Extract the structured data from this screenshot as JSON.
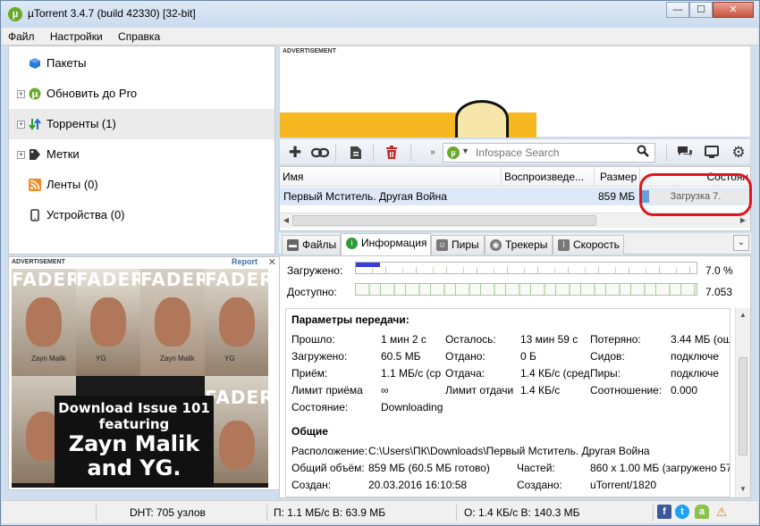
{
  "window": {
    "title": "µTorrent 3.4.7  (build 42330) [32-bit]",
    "controls": {
      "minimize": "—",
      "maximize": "☐",
      "close": "✕"
    }
  },
  "menu": [
    "Файл",
    "Настройки",
    "Справка"
  ],
  "sidebar": {
    "items": [
      {
        "label": "Пакеты",
        "icon": "package-icon"
      },
      {
        "label": "Обновить до Pro",
        "icon": "utorrent-logo-icon"
      },
      {
        "label": "Торренты (1)",
        "icon": "torrents-arrows-icon"
      },
      {
        "label": "Метки",
        "icon": "tag-icon"
      },
      {
        "label": "Ленты (0)",
        "icon": "rss-icon"
      },
      {
        "label": "Устройства (0)",
        "icon": "device-icon"
      }
    ]
  },
  "left_ad": {
    "label": "ADVERTISEMENT",
    "report": "Report",
    "close": "✕",
    "magazine_title": "FADER",
    "cover_names": [
      "Zayn Malik",
      "YG"
    ],
    "line1": "Download Issue 101",
    "line2": "featuring",
    "line3": "Zayn Malik",
    "line4": "and YG."
  },
  "top_ad": {
    "label": "ADVERTISEMENT"
  },
  "toolbar": {
    "search_placeholder": "Infospace Search",
    "icons": [
      "add-torrent-icon",
      "add-link-icon",
      "create-torrent-icon",
      "delete-icon",
      "chat-icon",
      "remote-icon",
      "settings-icon"
    ]
  },
  "torrent_list": {
    "columns": [
      "Имя",
      "Воспроизведе...",
      "Размер",
      "Состоян"
    ],
    "rows": [
      {
        "name": "Первый Мститель. Другая Война",
        "play": "",
        "size": "859 МБ",
        "status": "Загрузка 7.",
        "progress": 0.07
      }
    ]
  },
  "tabs": [
    {
      "label": "Файлы",
      "icon": "folder-icon"
    },
    {
      "label": "Информация",
      "icon": "info-icon",
      "active": true
    },
    {
      "label": "Пиры",
      "icon": "peers-icon"
    },
    {
      "label": "Трекеры",
      "icon": "trackers-icon"
    },
    {
      "label": "Скорость",
      "icon": "speed-chart-icon"
    }
  ],
  "progress": {
    "downloaded_label": "Загружено:",
    "downloaded_value": "7.0 %",
    "downloaded_fraction": 0.07,
    "available_label": "Доступно:",
    "available_value": "7.053"
  },
  "transfer": {
    "title": "Параметры передачи:",
    "col1": [
      {
        "label": "Прошло:",
        "value": "1 мин 2 с"
      },
      {
        "label": "Загружено:",
        "value": "60.5 МБ"
      },
      {
        "label": "Приём:",
        "value": "1.1 МБ/с (ср"
      },
      {
        "label": "Лимит приёма",
        "value": "∞"
      },
      {
        "label": "Состояние:",
        "value": "Downloading"
      }
    ],
    "col2": [
      {
        "label": "Осталось:",
        "value": "13 мин 59 с"
      },
      {
        "label": "Отдано:",
        "value": "0 Б"
      },
      {
        "label": "Отдача:",
        "value": "1.4 КБ/с (сред"
      },
      {
        "label": "Лимит отдачи",
        "value": "1.4 КБ/с"
      }
    ],
    "col3": [
      {
        "label": "Потеряно:",
        "value": "3.44 МБ (ош"
      },
      {
        "label": "Сидов:",
        "value": "подключе"
      },
      {
        "label": "Пиры:",
        "value": "подключе"
      },
      {
        "label": "Соотношение:",
        "value": "0.000"
      }
    ]
  },
  "general": {
    "title": "Общие",
    "location_label": "Расположение:",
    "location_value": "C:\\Users\\ПК\\Downloads\\Первый Мститель. Другая Война",
    "total_label": "Общий объём:",
    "total_value": "859 МБ (60.5 МБ готово)",
    "pieces_label": "Частей:",
    "pieces_value": "860 x 1.00 МБ (загружено 57)",
    "created_label": "Создан:",
    "created_value": "20.03.2016 16:10:58",
    "created_by_label": "Создано:",
    "created_by_value": "uTorrent/1820"
  },
  "statusbar": {
    "dht": "DHT: 705 узлов",
    "incoming": "П: 1.1 МБ/с В: 63.9 МБ",
    "outgoing": "О: 1.4 КБ/с В: 140.3 МБ"
  }
}
